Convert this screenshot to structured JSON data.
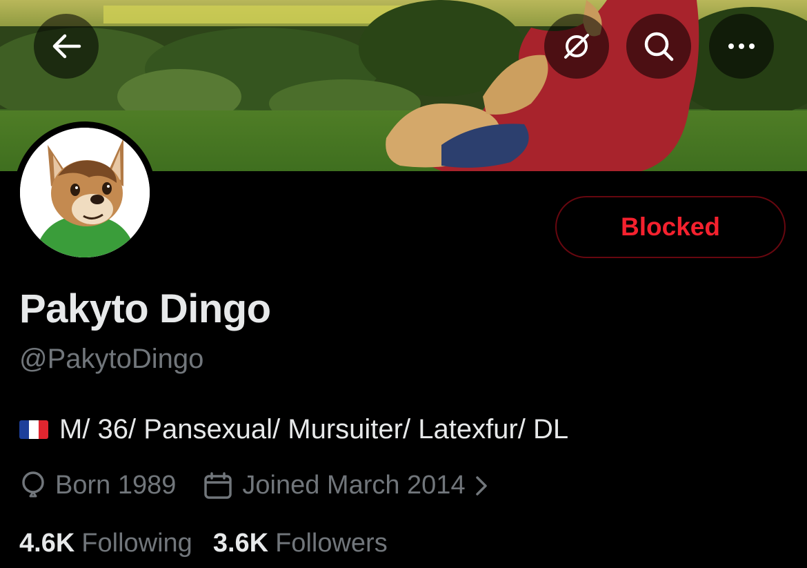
{
  "header": {
    "back_icon": "arrow-left-icon",
    "unlink_icon": "no-link-icon",
    "search_icon": "search-icon",
    "more_icon": "more-dots-icon"
  },
  "profile": {
    "display_name": "Pakyto Dingo",
    "handle": "@PakytoDingo",
    "bio_flag": "french-flag",
    "bio": "M/ 36/ Pansexual/ Mursuiter/ Latexfur/ DL",
    "born": "Born 1989",
    "joined": "Joined March 2014"
  },
  "actions": {
    "blocked_label": "Blocked"
  },
  "stats": {
    "following_count": "4.6K",
    "following_label": "Following",
    "followers_count": "3.6K",
    "followers_label": "Followers"
  },
  "colors": {
    "background": "#000000",
    "text_primary": "#e7e9ea",
    "text_secondary": "#71767b",
    "blocked_red": "#f4212e",
    "blocked_border": "#67070f"
  }
}
